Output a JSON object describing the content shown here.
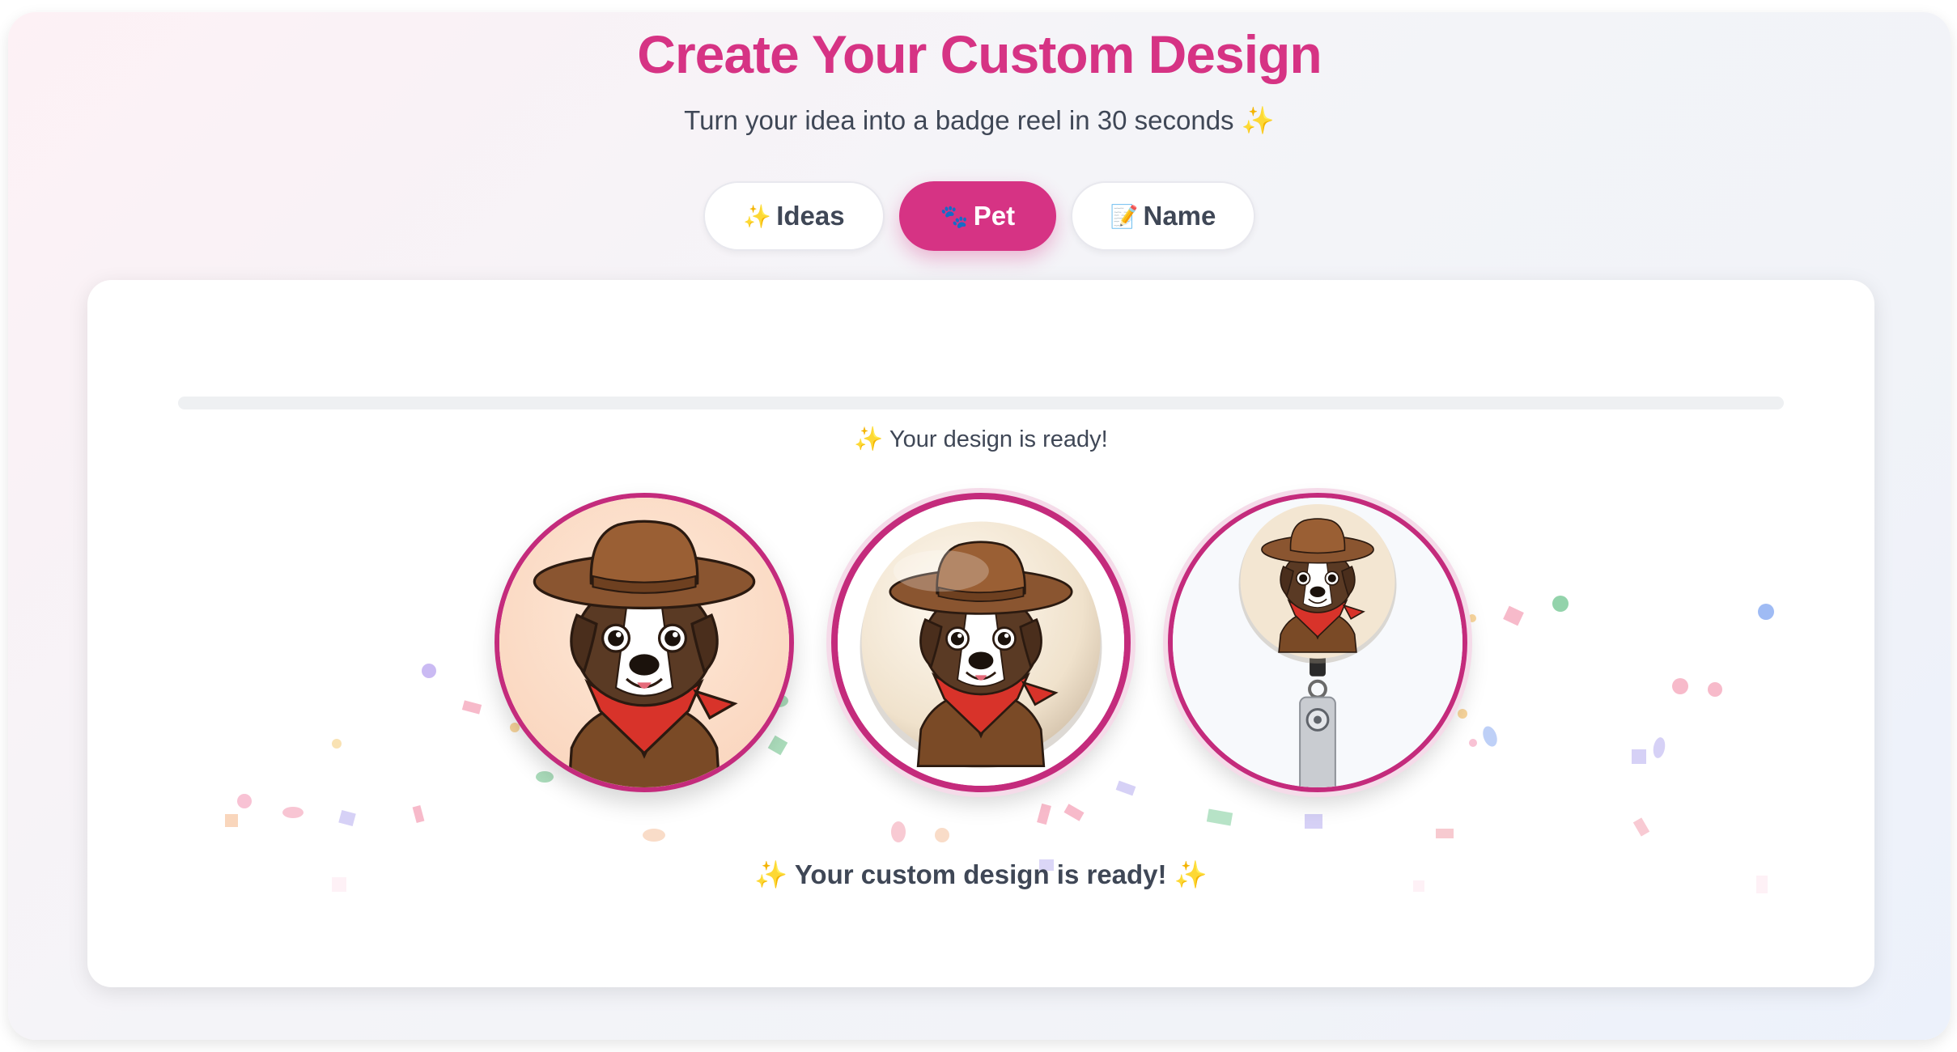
{
  "header": {
    "title": "Create Your Custom Design",
    "subtitle": "Turn your idea into a badge reel in 30 seconds ✨"
  },
  "tabs": [
    {
      "emoji": "✨",
      "label": "Ideas",
      "active": false
    },
    {
      "emoji": "🐾",
      "label": "Pet",
      "active": true
    },
    {
      "emoji": "📝",
      "label": "Name",
      "active": false
    }
  ],
  "result": {
    "status": "✨ Your design is ready!",
    "message": "✨ Your custom design is ready! ✨",
    "previews": [
      {
        "name": "flat-badge"
      },
      {
        "name": "3d-button"
      },
      {
        "name": "badge-reel"
      }
    ]
  },
  "colors": {
    "accent": "#d63384",
    "text": "#3f4756",
    "badge_border": "#c42b7c"
  }
}
